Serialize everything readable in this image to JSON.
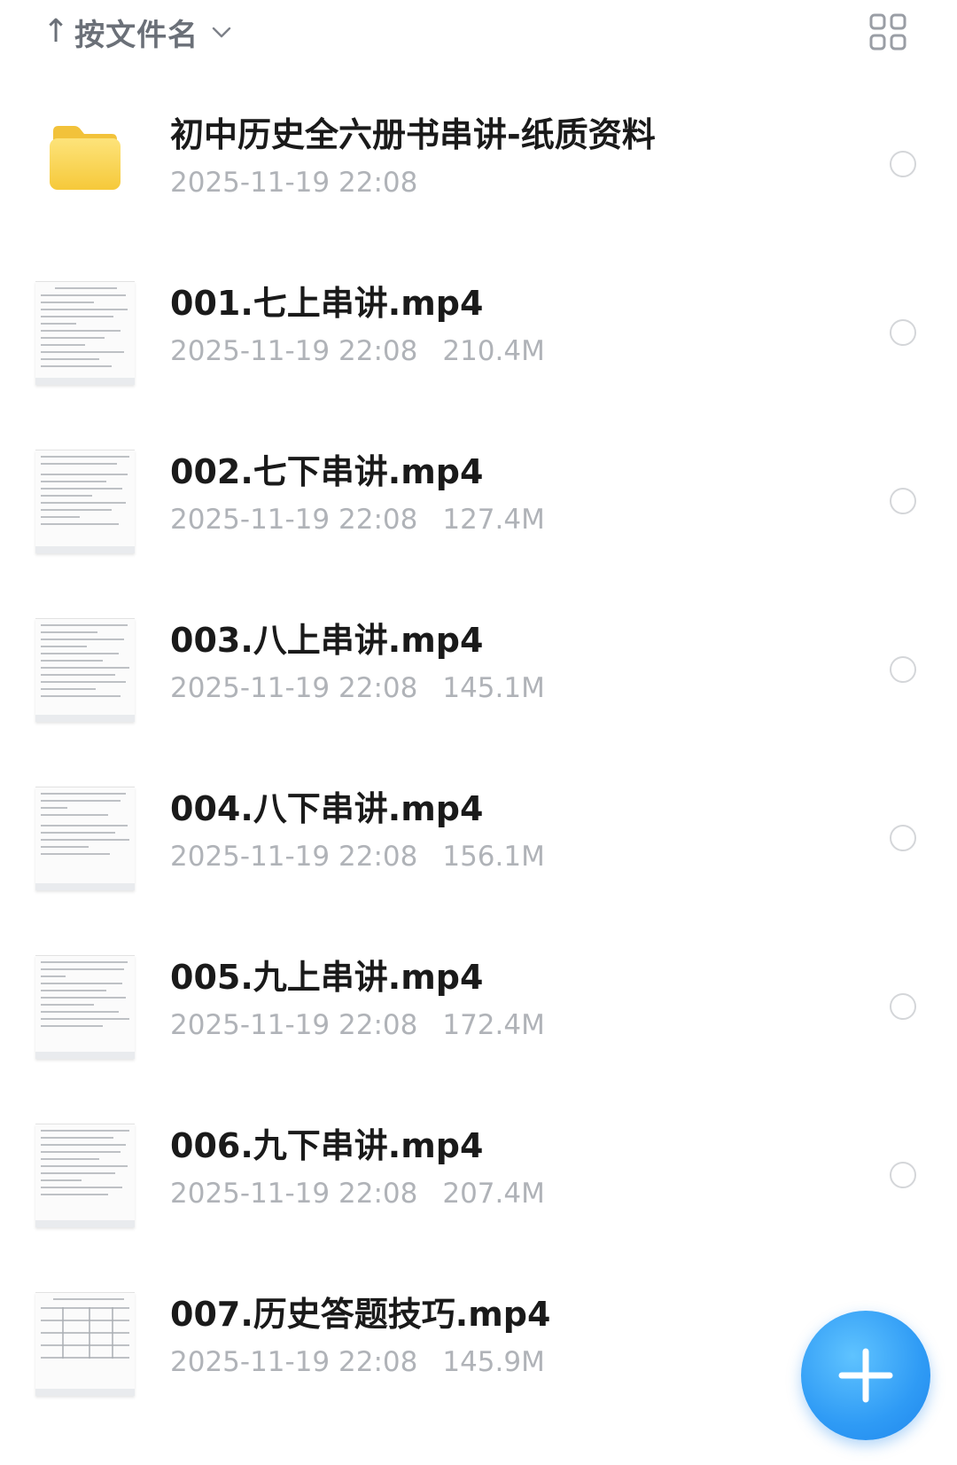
{
  "header": {
    "sort_arrow": "↑",
    "sort_label": "按文件名",
    "chevron_icon": "chevron-down-icon",
    "view_toggle_icon": "grid-view-icon"
  },
  "files": [
    {
      "name": "初中历史全六册书串讲-纸质资料",
      "date": "2025-11-19 22:08",
      "size": "",
      "type": "folder"
    },
    {
      "name": "001.七上串讲.mp4",
      "date": "2025-11-19 22:08",
      "size": "210.4M",
      "type": "video"
    },
    {
      "name": "002.七下串讲.mp4",
      "date": "2025-11-19 22:08",
      "size": "127.4M",
      "type": "video"
    },
    {
      "name": "003.八上串讲.mp4",
      "date": "2025-11-19 22:08",
      "size": "145.1M",
      "type": "video"
    },
    {
      "name": "004.八下串讲.mp4",
      "date": "2025-11-19 22:08",
      "size": "156.1M",
      "type": "video"
    },
    {
      "name": "005.九上串讲.mp4",
      "date": "2025-11-19 22:08",
      "size": "172.4M",
      "type": "video"
    },
    {
      "name": "006.九下串讲.mp4",
      "date": "2025-11-19 22:08",
      "size": "207.4M",
      "type": "video"
    },
    {
      "name": "007.历史答题技巧.mp4",
      "date": "2025-11-19 22:08",
      "size": "145.9M",
      "type": "video"
    }
  ],
  "fab": {
    "icon": "plus-icon"
  },
  "colors": {
    "accent": "#2f9bf5",
    "folder": "#f8d24a",
    "meta_text": "#b0b3b8",
    "name_text": "#1a1a1a"
  }
}
